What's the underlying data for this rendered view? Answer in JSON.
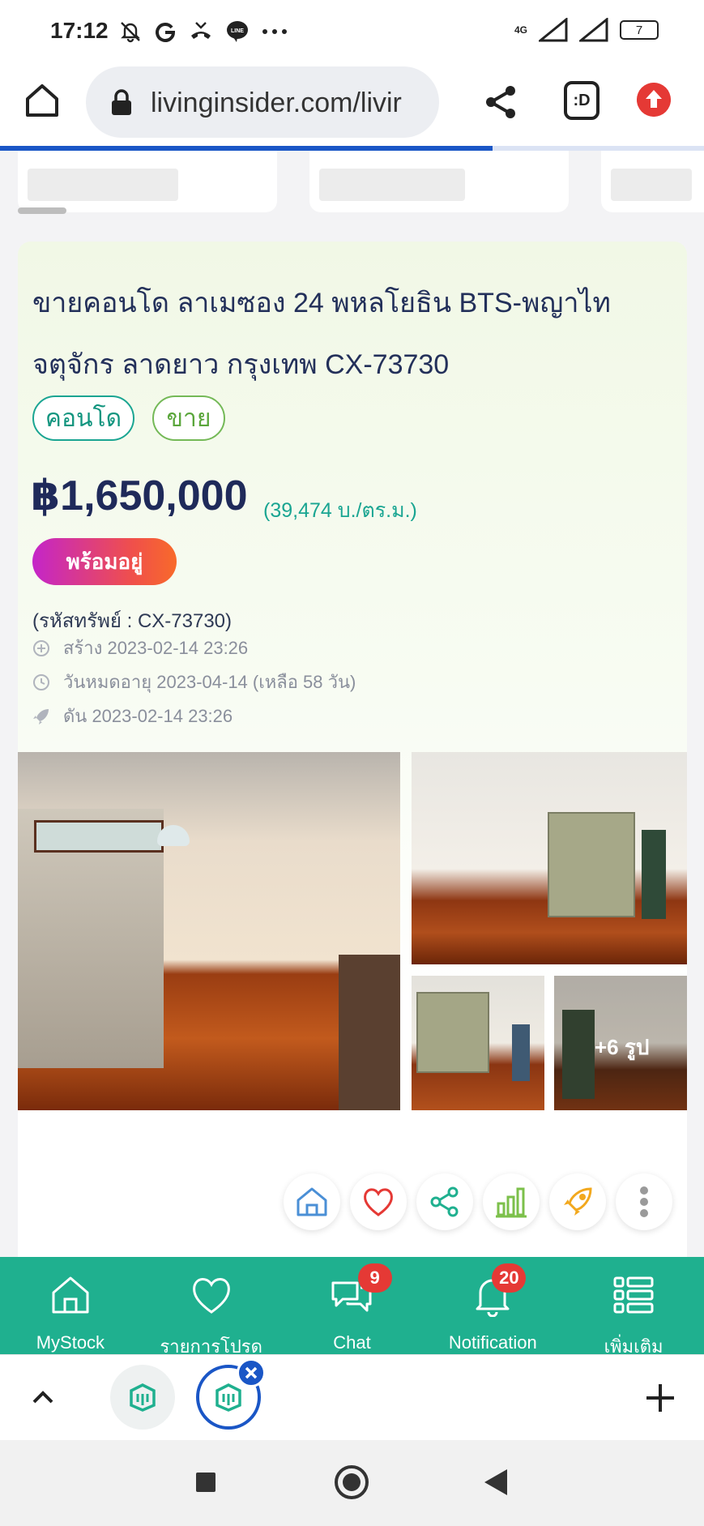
{
  "status_bar": {
    "time": "17:12",
    "network": "4G",
    "battery": "7"
  },
  "browser": {
    "url": "livinginsider.com/livir",
    "tabs_icon_text": ":D"
  },
  "listing": {
    "title": "ขายคอนโด ลาเมซอง 24 พหลโยธิน BTS-พญาไท จตุจักร ลาดยาว กรุงเทพ CX-73730",
    "tags": [
      "คอนโด",
      "ขาย"
    ],
    "price": "฿1,650,000",
    "price_per_sqm": "(39,474 บ./ตร.ม.)",
    "status_badge": "พร้อมอยู่",
    "property_code": "(รหัสทรัพย์ : CX-73730)",
    "created": "สร้าง 2023-02-14 23:26",
    "expires": "วันหมดอายุ 2023-04-14  (เหลือ 58 วัน)",
    "boosted": "ดัน 2023-02-14 23:26",
    "more_photos": "+6 รูป"
  },
  "app_nav": {
    "items": [
      {
        "label": "MyStock",
        "icon": "home-outline-icon"
      },
      {
        "label": "รายการโปรด",
        "icon": "heart-outline-icon"
      },
      {
        "label": "Chat",
        "icon": "chat-bubbles-icon",
        "badge": "9"
      },
      {
        "label": "Notification",
        "icon": "bell-icon",
        "badge": "20"
      },
      {
        "label": "เพิ่มเติม",
        "icon": "list-icon"
      }
    ]
  },
  "colors": {
    "accent": "#1fb08f",
    "price": "#1f2a5a",
    "badge": "#e53935",
    "browser_accent": "#1a56c6"
  }
}
